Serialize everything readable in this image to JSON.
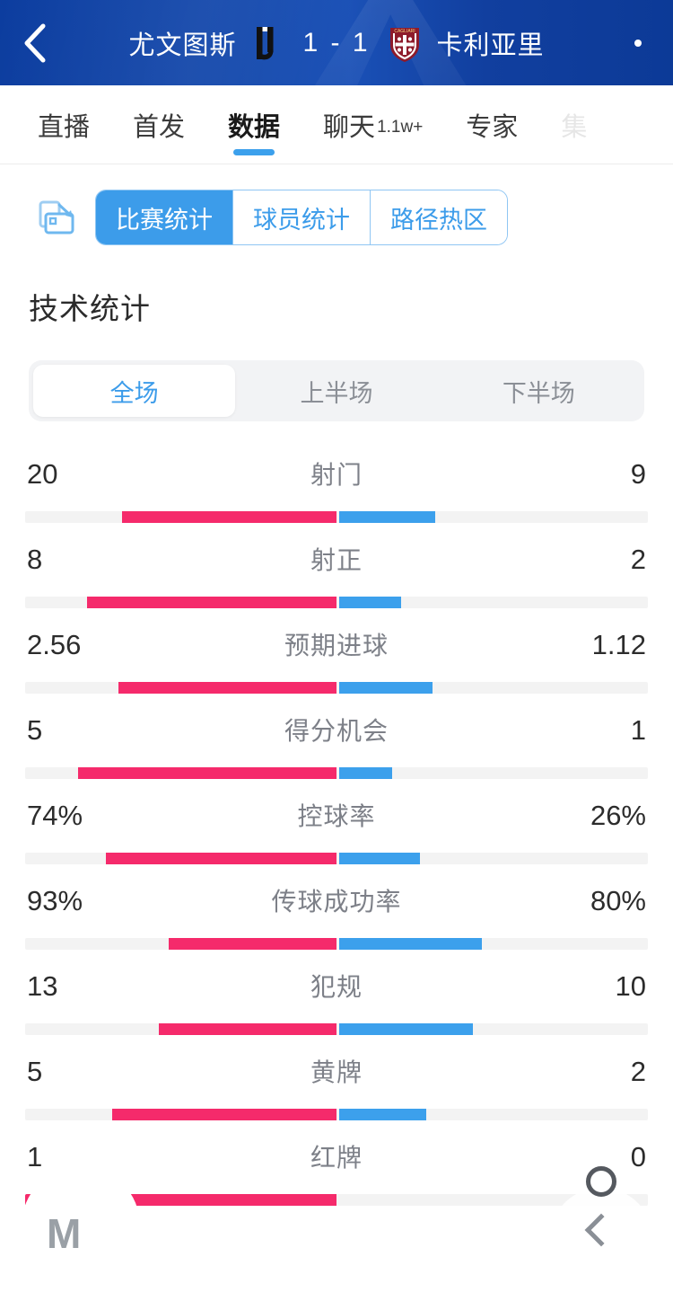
{
  "header": {
    "back_icon": "chevron-left-icon",
    "home_team": "尤文图斯",
    "home_crest": "juventus-crest",
    "score": "1 - 1",
    "away_team": "卡利亚里",
    "away_crest": "cagliari-crest",
    "more_icon": "more-horizontal-icon",
    "background_color": "#0e3fa0"
  },
  "tabs": [
    {
      "label": "直播",
      "badge": "",
      "active": false
    },
    {
      "label": "首发",
      "badge": "",
      "active": false
    },
    {
      "label": "数据",
      "badge": "",
      "active": true
    },
    {
      "label": "聊天",
      "badge": "1.1w+",
      "active": false
    },
    {
      "label": "专家",
      "badge": "",
      "active": false
    },
    {
      "label": "集",
      "badge": "",
      "active": false
    }
  ],
  "segment": {
    "rotate_icon": "rotate-screen-icon",
    "items": [
      {
        "label": "比赛统计",
        "active": true
      },
      {
        "label": "球员统计",
        "active": false
      },
      {
        "label": "路径热区",
        "active": false
      }
    ]
  },
  "section": {
    "title": "技术统计"
  },
  "half_selector": [
    {
      "label": "全场",
      "active": true
    },
    {
      "label": "上半场",
      "active": false
    },
    {
      "label": "下半场",
      "active": false
    }
  ],
  "colors": {
    "home_bar": "#f52a6b",
    "away_bar": "#3ca0ec",
    "track": "#f3f3f3",
    "accent": "#3ca0ec",
    "header": "#0e3fa0"
  },
  "chart_data": {
    "type": "bar",
    "title": "技术统计",
    "subtitle": "全场",
    "orientation": "horizontal-diverging",
    "legend": [
      "尤文图斯",
      "卡利亚里"
    ],
    "categories": [
      "射门",
      "射正",
      "预期进球",
      "得分机会",
      "控球率",
      "传球成功率",
      "犯规",
      "黄牌",
      "红牌"
    ],
    "series": [
      {
        "name": "尤文图斯",
        "values": [
          20,
          8,
          2.56,
          5,
          74,
          93,
          13,
          5,
          1
        ]
      },
      {
        "name": "卡利亚里",
        "values": [
          9,
          2,
          1.12,
          1,
          26,
          80,
          10,
          2,
          0
        ]
      }
    ],
    "rows": [
      {
        "label": "射门",
        "home": "20",
        "away": "9",
        "home_pct": 69,
        "away_pct": 31
      },
      {
        "label": "射正",
        "home": "8",
        "away": "2",
        "home_pct": 80,
        "away_pct": 20
      },
      {
        "label": "预期进球",
        "home": "2.56",
        "away": "1.12",
        "home_pct": 70,
        "away_pct": 30
      },
      {
        "label": "得分机会",
        "home": "5",
        "away": "1",
        "home_pct": 83,
        "away_pct": 17
      },
      {
        "label": "控球率",
        "home": "74%",
        "away": "26%",
        "home_pct": 74,
        "away_pct": 26
      },
      {
        "label": "传球成功率",
        "home": "93%",
        "away": "80%",
        "home_pct": 54,
        "away_pct": 46
      },
      {
        "label": "犯规",
        "home": "13",
        "away": "10",
        "home_pct": 57,
        "away_pct": 43
      },
      {
        "label": "黄牌",
        "home": "5",
        "away": "2",
        "home_pct": 72,
        "away_pct": 28
      },
      {
        "label": "红牌",
        "home": "1",
        "away": "0",
        "home_pct": 100,
        "away_pct": 0
      }
    ]
  },
  "overlay": {
    "left_mark": "M",
    "right_icon": "chevron-up-icon"
  }
}
